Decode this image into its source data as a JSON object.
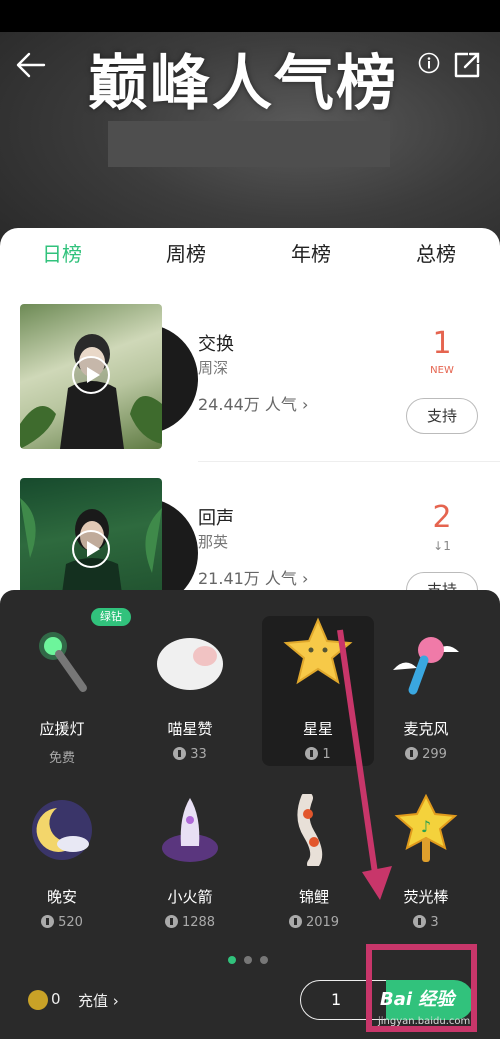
{
  "header": {
    "title": "巅峰人气榜"
  },
  "tabs": [
    {
      "label": "日榜",
      "active": true
    },
    {
      "label": "周榜",
      "active": false
    },
    {
      "label": "年榜",
      "active": false
    },
    {
      "label": "总榜",
      "active": false
    }
  ],
  "songs": [
    {
      "title": "交换",
      "artist": "周深",
      "popularity": "24.44万 人气 ›",
      "rank": "1",
      "rank_note": "NEW",
      "support_label": "支持"
    },
    {
      "title": "回声",
      "artist": "那英",
      "popularity": "21.41万 人气 ›",
      "rank": "2",
      "rank_note": "↓1",
      "support_label": "支持"
    }
  ],
  "gifts_badge": "绿钻",
  "gifts": [
    {
      "name": "应援灯",
      "price": "免费"
    },
    {
      "name": "喵星赞",
      "price": "33"
    },
    {
      "name": "星星",
      "price": "1"
    },
    {
      "name": "麦克风",
      "price": "299"
    },
    {
      "name": "晚安",
      "price": "520"
    },
    {
      "name": "小火箭",
      "price": "1288"
    },
    {
      "name": "锦鲤",
      "price": "2019"
    },
    {
      "name": "荧光棒",
      "price": "3"
    }
  ],
  "footer": {
    "balance": "0",
    "recharge": "充值 ›",
    "quantity": "1"
  },
  "watermark": {
    "brand": "Bai 经验",
    "url": "jingyan.baidu.com"
  },
  "colors": {
    "accent": "#31c27c",
    "rank": "#e5644f",
    "annotation": "#c8366a"
  }
}
